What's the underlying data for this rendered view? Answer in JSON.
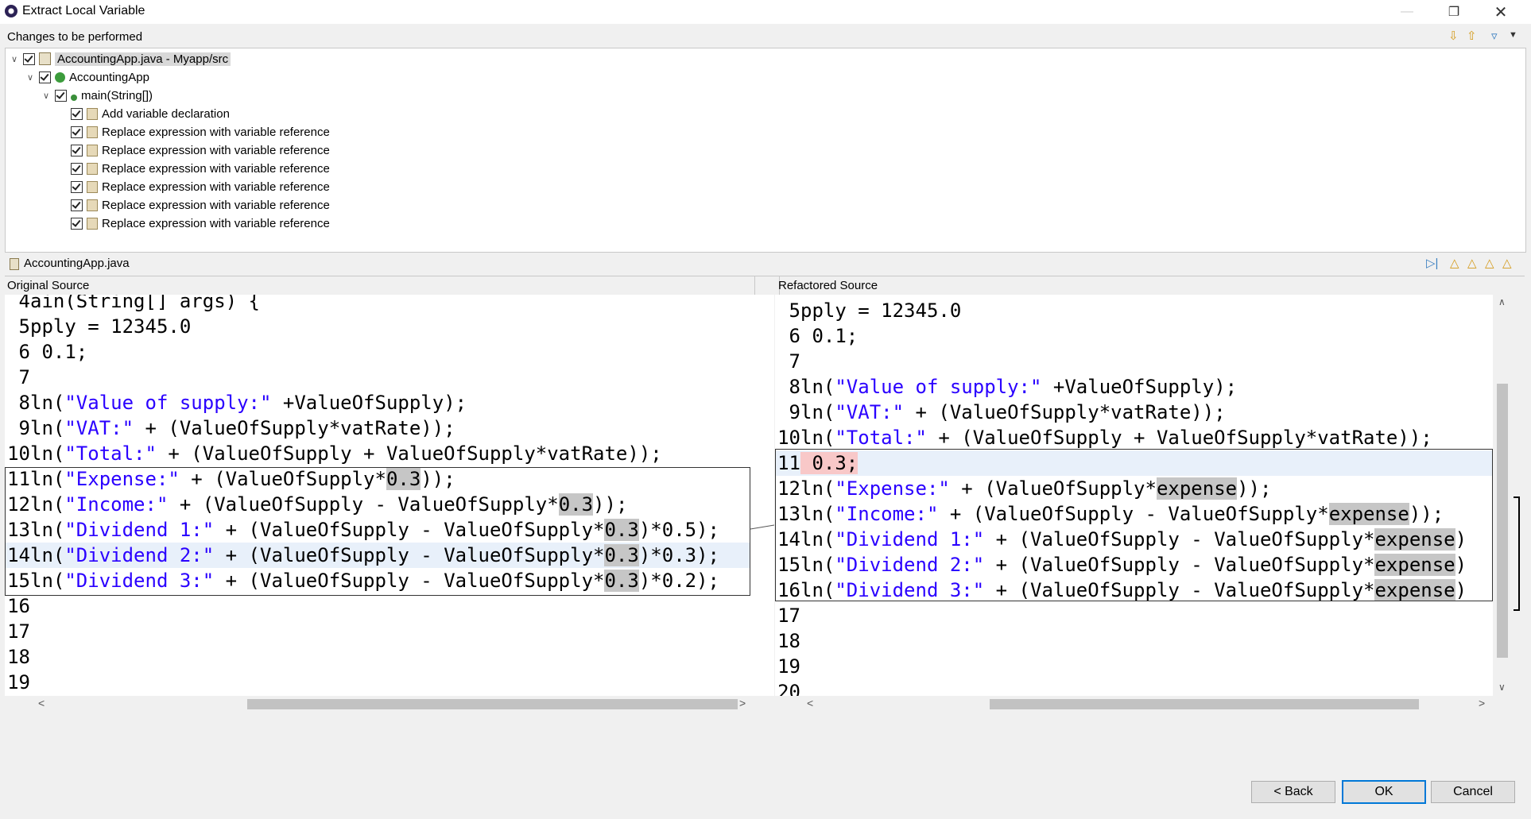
{
  "window": {
    "title": "Extract Local Variable"
  },
  "changes": {
    "label": "Changes to be performed",
    "tree": [
      {
        "label": "AccountingApp.java - Myapp/src",
        "icon": "java-file-icon"
      },
      {
        "label": "AccountingApp",
        "icon": "class-icon"
      },
      {
        "label": "main(String[])",
        "icon": "method-icon"
      },
      {
        "label": "Add variable declaration",
        "icon": "change-icon"
      },
      {
        "label": "Replace expression with variable reference",
        "icon": "change-icon"
      },
      {
        "label": "Replace expression with variable reference",
        "icon": "change-icon"
      },
      {
        "label": "Replace expression with variable reference",
        "icon": "change-icon"
      },
      {
        "label": "Replace expression with variable reference",
        "icon": "change-icon"
      },
      {
        "label": "Replace expression with variable reference",
        "icon": "change-icon"
      },
      {
        "label": "Replace expression with variable reference",
        "icon": "change-icon"
      }
    ]
  },
  "compare": {
    "file": "AccountingApp.java",
    "original_header": "Original Source",
    "refactored_header": "Refactored Source",
    "original_lines": [
      {
        "n": "4",
        "text": "ain(String[] args) {"
      },
      {
        "n": "5",
        "text": "pply = 12345.0"
      },
      {
        "n": "6",
        "text": " 0.1;"
      },
      {
        "n": "7",
        "text": ""
      },
      {
        "n": "8",
        "pre": "ln(",
        "str": "\"Value of supply:\"",
        "post": " +ValueOfSupply);"
      },
      {
        "n": "9",
        "pre": "ln(",
        "str": "\"VAT:\"",
        "post": " + (ValueOfSupply*vatRate));"
      },
      {
        "n": "10",
        "pre": "ln(",
        "str": "\"Total:\"",
        "post": " + (ValueOfSupply + ValueOfSupply*vatRate));"
      },
      {
        "n": "11",
        "pre": "ln(",
        "str": "\"Expense:\"",
        "post": " + (ValueOfSupply*",
        "hl": "0.3",
        "tail": "));"
      },
      {
        "n": "12",
        "pre": "ln(",
        "str": "\"Income:\"",
        "post": " + (ValueOfSupply - ValueOfSupply*",
        "hl": "0.3",
        "tail": "));"
      },
      {
        "n": "13",
        "pre": "ln(",
        "str": "\"Dividend 1:\"",
        "post": " + (ValueOfSupply - ValueOfSupply*",
        "hl": "0.3",
        "tail": ")*0.5);"
      },
      {
        "n": "14",
        "pre": "ln(",
        "str": "\"Dividend 2:\"",
        "post": " + (ValueOfSupply - ValueOfSupply*",
        "hl": "0.3",
        "tail": ")*0.3);"
      },
      {
        "n": "15",
        "pre": "ln(",
        "str": "\"Dividend 3:\"",
        "post": " + (ValueOfSupply - ValueOfSupply*",
        "hl": "0.3",
        "tail": ")*0.2);"
      },
      {
        "n": "16",
        "text": ""
      },
      {
        "n": "17",
        "text": ""
      },
      {
        "n": "18",
        "text": ""
      },
      {
        "n": "19",
        "text": ""
      }
    ],
    "refactored_lines": [
      {
        "n": "5",
        "text": "pply = 12345.0"
      },
      {
        "n": "6",
        "text": " 0.1;"
      },
      {
        "n": "7",
        "text": ""
      },
      {
        "n": "8",
        "pre": "ln(",
        "str": "\"Value of supply:\"",
        "post": " +ValueOfSupply);"
      },
      {
        "n": "9",
        "pre": "ln(",
        "str": "\"VAT:\"",
        "post": " + (ValueOfSupply*vatRate));"
      },
      {
        "n": "10",
        "pre": "ln(",
        "str": "\"Total:\"",
        "post": " + (ValueOfSupply + ValueOfSupply*vatRate));"
      },
      {
        "n": "11",
        "added": " 0.3;"
      },
      {
        "n": "12",
        "pre": "ln(",
        "str": "\"Expense:\"",
        "post": " + (ValueOfSupply*",
        "hl": "expense",
        "tail": "));"
      },
      {
        "n": "13",
        "pre": "ln(",
        "str": "\"Income:\"",
        "post": " + (ValueOfSupply - ValueOfSupply*",
        "hl": "expense",
        "tail": "));"
      },
      {
        "n": "14",
        "pre": "ln(",
        "str": "\"Dividend 1:\"",
        "post": " + (ValueOfSupply - ValueOfSupply*",
        "hl": "expense",
        "tail": ")"
      },
      {
        "n": "15",
        "pre": "ln(",
        "str": "\"Dividend 2:\"",
        "post": " + (ValueOfSupply - ValueOfSupply*",
        "hl": "expense",
        "tail": ")"
      },
      {
        "n": "16",
        "pre": "ln(",
        "str": "\"Dividend 3:\"",
        "post": " + (ValueOfSupply - ValueOfSupply*",
        "hl": "expense",
        "tail": ")"
      },
      {
        "n": "17",
        "text": ""
      },
      {
        "n": "18",
        "text": ""
      },
      {
        "n": "19",
        "text": ""
      },
      {
        "n": "20",
        "text": ""
      }
    ]
  },
  "buttons": {
    "back": "< Back",
    "ok": "OK",
    "cancel": "Cancel"
  },
  "colors": {
    "string": "#2a00ff",
    "highlight": "#c6c6c6",
    "added_bg": "#f8c8c8",
    "selected_row": "#e8f0fa",
    "default_button_border": "#0078d7"
  }
}
